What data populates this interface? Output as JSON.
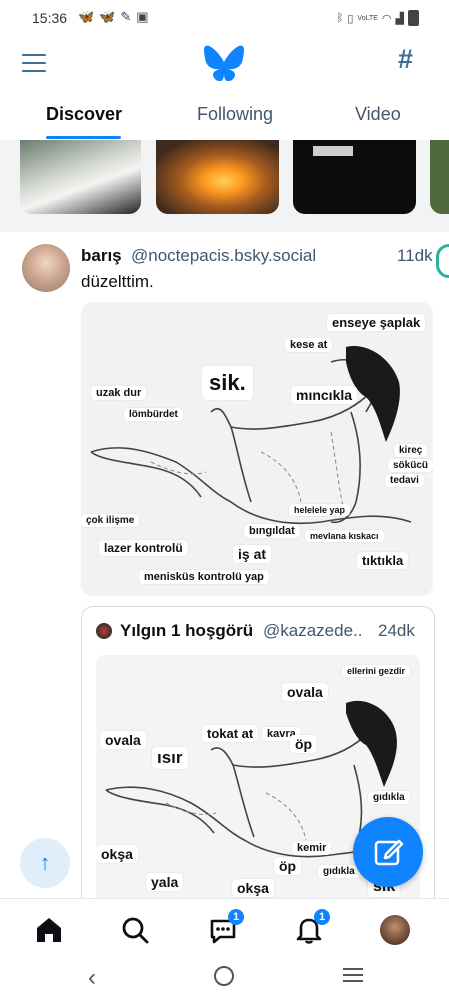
{
  "status_bar": {
    "time": "15:36",
    "left_icons": [
      "bluesky-icon",
      "bluesky-icon",
      "app-icon",
      "app-icon"
    ],
    "right_icons": [
      "bluetooth-icon",
      "vibrate-icon",
      "lte-icon",
      "wifi-icon",
      "signal-icon",
      "battery-icon"
    ],
    "lte_text": "VoLTE"
  },
  "header": {
    "menu_icon": "hamburger-icon",
    "logo_icon": "bluesky-butterfly-icon",
    "feeds_icon": "hashtag-icon"
  },
  "tabs": [
    {
      "label": "Discover",
      "active": true
    },
    {
      "label": "Following",
      "active": false
    },
    {
      "label": "Video",
      "active": false
    }
  ],
  "post": {
    "display_name": "barış",
    "handle": "@noctepacis.bsky.social",
    "time": "11dk",
    "text": "düzelttim.",
    "image_labels": [
      "enseye şaplak",
      "kese at",
      "sik.",
      "mıncıkla",
      "uzak dur",
      "lömbürdet",
      "kireç",
      "sökücü",
      "tedavi",
      "helelele yap",
      "çok ilişme",
      "bıngıldat",
      "mevlana kıskacı",
      "lazer kontrolü",
      "iş at",
      "tıktıkla",
      "menisküs kontrolü yap"
    ]
  },
  "quote": {
    "display_name": "Yılgın 1 hoşgörü",
    "handle": "@kazazede..",
    "time": "24dk",
    "image_labels": [
      "ellerini gezdir",
      "ovala",
      "ovala",
      "tokat at",
      "kavra",
      "öp",
      "ısır",
      "gıdıkla",
      "okşa",
      "kemir",
      "öp",
      "gıdıkla",
      "yala",
      "okşa",
      "sik"
    ]
  },
  "bottom_nav": {
    "items": [
      {
        "name": "home",
        "icon": "home-icon",
        "active": true
      },
      {
        "name": "search",
        "icon": "search-icon"
      },
      {
        "name": "chat",
        "icon": "chat-icon",
        "badge": "1"
      },
      {
        "name": "notifications",
        "icon": "bell-icon",
        "badge": "1"
      },
      {
        "name": "profile",
        "icon": "avatar"
      }
    ]
  },
  "system_nav": [
    "back-icon",
    "home-circle-icon",
    "recents-icon"
  ],
  "colors": {
    "accent": "#1083fe",
    "muted_text": "#42576c",
    "icon_blue": "#3b6f93"
  }
}
